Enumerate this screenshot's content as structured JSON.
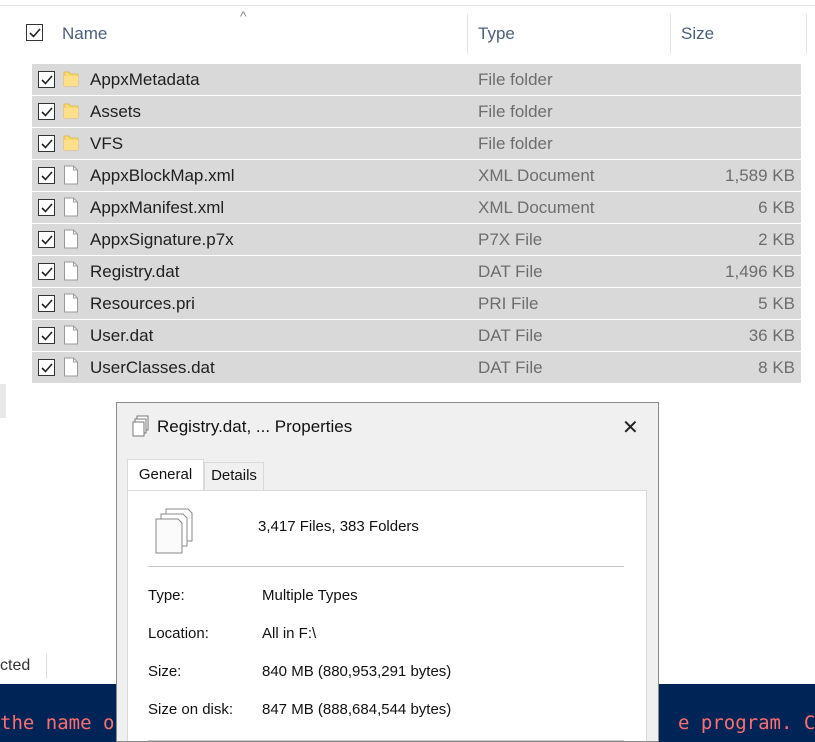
{
  "explorer": {
    "columns": {
      "name": "Name",
      "type": "Type",
      "size": "Size"
    },
    "rows": [
      {
        "name": "AppxMetadata",
        "type": "File folder",
        "size": "",
        "kind": "folder"
      },
      {
        "name": "Assets",
        "type": "File folder",
        "size": "",
        "kind": "folder"
      },
      {
        "name": "VFS",
        "type": "File folder",
        "size": "",
        "kind": "folder"
      },
      {
        "name": "AppxBlockMap.xml",
        "type": "XML Document",
        "size": "1,589 KB",
        "kind": "file"
      },
      {
        "name": "AppxManifest.xml",
        "type": "XML Document",
        "size": "6 KB",
        "kind": "file"
      },
      {
        "name": "AppxSignature.p7x",
        "type": "P7X File",
        "size": "2 KB",
        "kind": "file"
      },
      {
        "name": "Registry.dat",
        "type": "DAT File",
        "size": "1,496 KB",
        "kind": "file"
      },
      {
        "name": "Resources.pri",
        "type": "PRI File",
        "size": "5 KB",
        "kind": "file"
      },
      {
        "name": "User.dat",
        "type": "DAT File",
        "size": "36 KB",
        "kind": "file"
      },
      {
        "name": "UserClasses.dat",
        "type": "DAT File",
        "size": "8 KB",
        "kind": "file"
      }
    ],
    "status": "cted"
  },
  "terminal": {
    "left_text": "the name o",
    "right_text": "e program. Che"
  },
  "dialog": {
    "title": "Registry.dat, ... Properties",
    "close": "✕",
    "tabs": {
      "general": "General",
      "details": "Details"
    },
    "summary": "3,417 Files, 383 Folders",
    "props": {
      "type_label": "Type:",
      "type_value": "Multiple Types",
      "location_label": "Location:",
      "location_value": "All in F:\\",
      "size_label": "Size:",
      "size_value": "840 MB (880,953,291 bytes)",
      "disk_label": "Size on disk:",
      "disk_value": "847 MB (888,684,544 bytes)"
    }
  },
  "icons": {
    "folder": "folder-icon",
    "file": "file-icon",
    "sort": "sort-up-icon",
    "check": "checkmark-icon"
  },
  "colors": {
    "row_selected": "#d9d9d9",
    "header_text": "#4c607a",
    "terminal_bg": "#012456",
    "terminal_text": "#ff6f6f"
  }
}
